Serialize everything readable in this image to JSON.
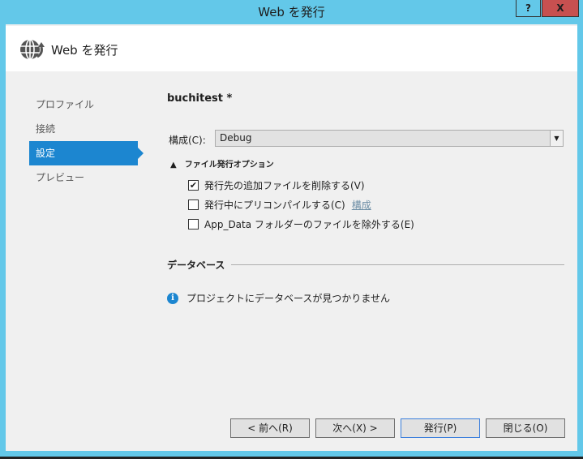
{
  "window": {
    "title": "Web を発行",
    "help": "?",
    "close": "X"
  },
  "header": {
    "title": "Web を発行",
    "icon": "globe-publish-icon"
  },
  "nav": {
    "items": [
      {
        "label": "プロファイル"
      },
      {
        "label": "接続"
      },
      {
        "label": "設定"
      },
      {
        "label": "プレビュー"
      }
    ],
    "selected": "設定"
  },
  "main": {
    "profile_name": "buchitest *",
    "config_label": "構成(C):",
    "config_value": "Debug",
    "section_title": "ファイル発行オプション",
    "options": [
      {
        "label": "発行先の追加ファイルを削除する(V)",
        "checked": true
      },
      {
        "label": "発行中にプリコンパイルする(C)",
        "checked": false,
        "link": "構成"
      },
      {
        "label": "App_Data フォルダーのファイルを除外する(E)",
        "checked": false
      }
    ],
    "database_title": "データベース",
    "database_info": "プロジェクトにデータベースが見つかりません"
  },
  "buttons": {
    "prev": "< 前へ(R)",
    "next": "次へ(X) >",
    "publish": "発行(P)",
    "close": "閉じる(O)"
  }
}
